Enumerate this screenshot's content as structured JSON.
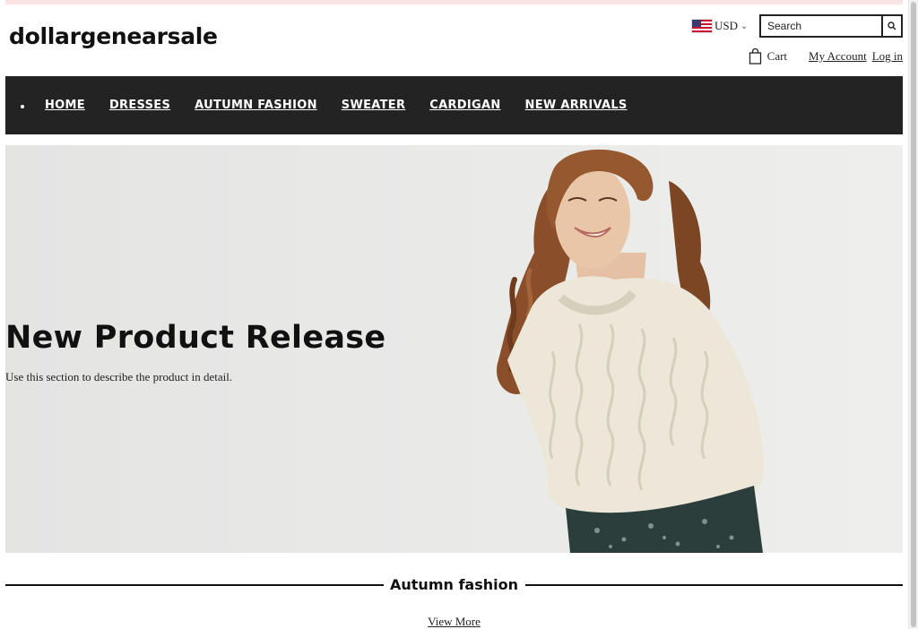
{
  "brand": {
    "logo_text": "dollargenearsale"
  },
  "header": {
    "currency": {
      "code": "USD",
      "flag": "us-flag-icon"
    },
    "search": {
      "placeholder": "Search",
      "icon": "search-icon"
    },
    "cart_label": "Cart",
    "my_account_label": "My Account",
    "login_label": "Log in"
  },
  "nav": {
    "items": [
      {
        "label": "HOME"
      },
      {
        "label": "DRESSES"
      },
      {
        "label": "AUTUMN FASHION"
      },
      {
        "label": "SWEATER"
      },
      {
        "label": "CARDIGAN"
      },
      {
        "label": "NEW ARRIVALS"
      }
    ]
  },
  "hero": {
    "title": "New Product Release",
    "description": "Use this section to describe the product in detail."
  },
  "collection": {
    "title": "Autumn fashion",
    "view_more_label": "View More"
  },
  "colors": {
    "announcement_bar": "#fbe3e4",
    "nav_background": "#232323",
    "nav_text": "#ffffff",
    "hero_background": "#e8e8e7",
    "sweater": "#ece7d9",
    "skirt": "#2b3e3b",
    "hair": "#8a4f2a"
  }
}
